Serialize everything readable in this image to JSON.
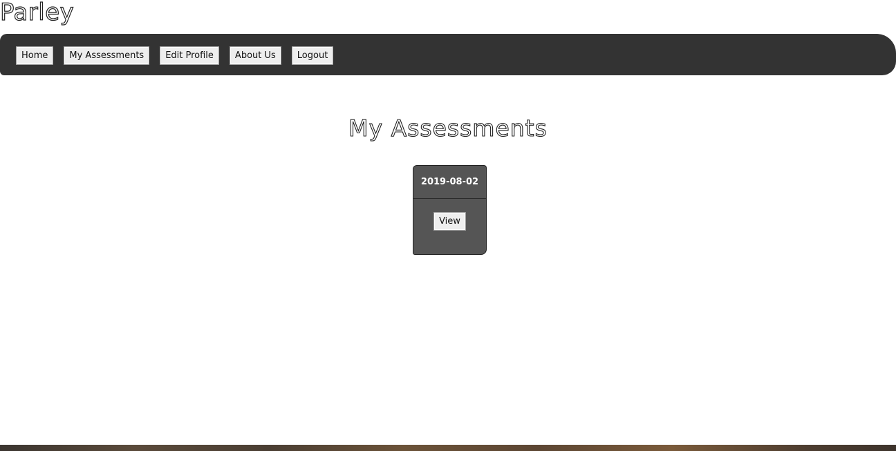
{
  "app": {
    "brand": "Parley"
  },
  "nav": {
    "items": [
      {
        "label": "Home"
      },
      {
        "label": "My Assessments"
      },
      {
        "label": "Edit Profile"
      },
      {
        "label": "About Us"
      },
      {
        "label": "Logout"
      }
    ]
  },
  "main": {
    "title": "My Assessments",
    "assessments": [
      {
        "date": "2019-08-02",
        "view_label": "View"
      }
    ]
  },
  "colors": {
    "navbar_bg": "#333333",
    "card_bg": "#555555",
    "button_bg": "#eeeeee"
  }
}
